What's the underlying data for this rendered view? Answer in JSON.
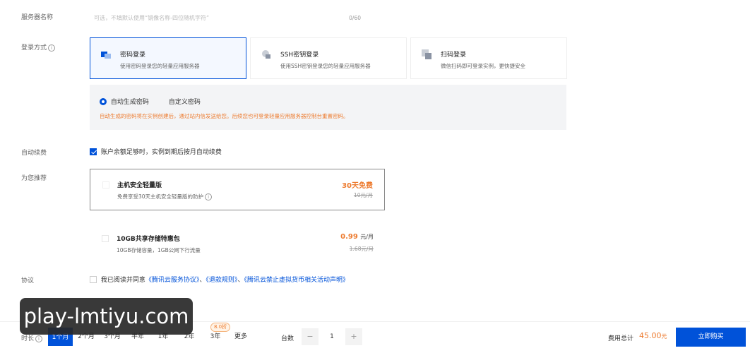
{
  "form": {
    "server_name": {
      "label": "服务器名称",
      "placeholder": "可选，不填默认使用“镜像名称-四位随机字符”",
      "counter": "0/60"
    },
    "login_method": {
      "label": "登录方式",
      "options": [
        {
          "title": "密码登录",
          "desc": "使用密码登录您的轻量应用服务器",
          "icon": "password-icon",
          "selected": true
        },
        {
          "title": "SSH密钥登录",
          "desc": "使用SSH密钥登录您的轻量应用服务器",
          "icon": "ssh-key-icon",
          "selected": false
        },
        {
          "title": "扫码登录",
          "desc": "微信扫码即可登录实例，更快捷安全",
          "icon": "qrcode-icon",
          "selected": false
        }
      ],
      "password_options": {
        "auto": "自动生成密码",
        "custom": "自定义密码",
        "notice": "自动生成的密码将在实例创建后，通过站内信发送给您。后续您也可登录轻量应用服务器控制台重置密码。"
      }
    },
    "auto_renew": {
      "label": "自动续费",
      "checkbox_text": "账户余额足够时，实例到期后按月自动续费",
      "checked": true
    },
    "recommend": {
      "label": "为您推荐",
      "items": [
        {
          "title": "主机安全轻量版",
          "desc": "免费享受30天主机安全轻量版的防护",
          "price": "30天免费",
          "orig": "10元/月"
        },
        {
          "title": "10GB共享存储特惠包",
          "desc": "10GB存储容量，1GB公网下行流量",
          "price": "0.99",
          "unit": "元/月",
          "orig": "1.68元/月"
        }
      ]
    },
    "agreement": {
      "label": "协议",
      "prefix": "我已阅读并同意",
      "link1": "《腾讯云服务协议》",
      "sep1": "、",
      "link2": "《退款规则》",
      "sep2": "、",
      "link3": "《腾讯云禁止虚拟货币相关活动声明》"
    }
  },
  "bottom": {
    "duration_label": "时长",
    "durations": [
      "1个月",
      "2个月",
      "3个月",
      "半年",
      "1年",
      "2年",
      "3年",
      "更多"
    ],
    "selected_duration": "1个月",
    "badge_visible": "8.0折",
    "quantity_label": "台数",
    "quantity": "1",
    "minus": "−",
    "plus": "+",
    "total_label": "费用总计",
    "total_value": "45.00",
    "total_unit": "元",
    "buy_label": "立即购买"
  },
  "watermark": "play-lmtiyu.com",
  "colors": {
    "accent": "#0052d9",
    "price": "#ed7b2f"
  }
}
